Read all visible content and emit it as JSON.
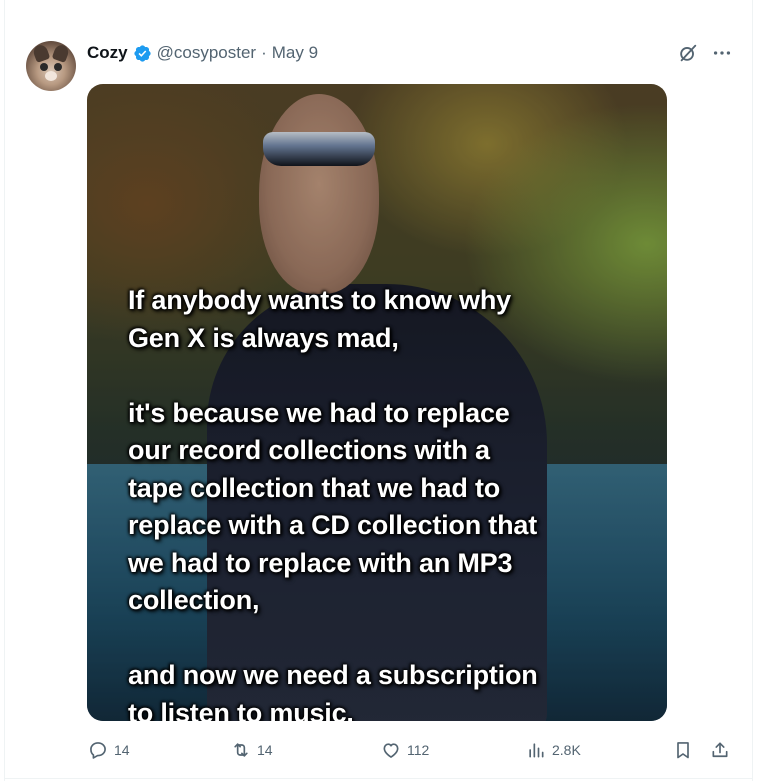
{
  "post": {
    "author_name": "Cozy",
    "handle": "@cosyposter",
    "separator": "·",
    "date": "May 9",
    "verified": true
  },
  "media": {
    "meme_text": "If anybody wants to know why\nGen X is always mad,\n\nit's because we had to replace\nour record collections with a\ntape collection that we had to\nreplace with a CD collection that\nwe had to replace with an MP3\ncollection,\n\nand now we need a subscription\nto listen to music."
  },
  "actions": {
    "replies": "14",
    "reposts": "14",
    "likes": "112",
    "views": "2.8K"
  },
  "icons": {
    "verified_color": "#1d9bf0",
    "muted_color": "#536471"
  }
}
